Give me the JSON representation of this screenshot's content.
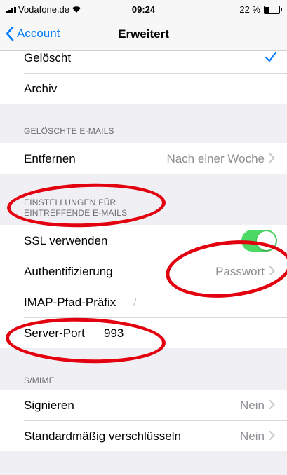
{
  "status_bar": {
    "carrier": "Vodafone.de",
    "time": "09:24",
    "battery": "22 %"
  },
  "nav": {
    "back_label": "Account",
    "title": "Erweitert"
  },
  "mailbox_behavior": {
    "rows": [
      {
        "label": "Gelöscht",
        "checked": true
      },
      {
        "label": "Archiv"
      }
    ]
  },
  "deleted_mails": {
    "header": "GELÖSCHTE E-MAILS",
    "remove": {
      "label": "Entfernen",
      "value": "Nach einer Woche"
    }
  },
  "incoming": {
    "header_line1": "EINSTELLUNGEN FÜR",
    "header_line2": "EINTREFFENDE E-MAILS",
    "ssl": {
      "label": "SSL verwenden",
      "on": true
    },
    "auth": {
      "label": "Authentifizierung",
      "value": "Passwort"
    },
    "imap_prefix": {
      "label": "IMAP-Pfad-Präfix",
      "value": "/"
    },
    "server_port": {
      "label": "Server-Port",
      "value": "993"
    }
  },
  "smime": {
    "header": "S/MIME",
    "sign": {
      "label": "Signieren",
      "value": "Nein"
    },
    "encrypt": {
      "label": "Standardmäßig verschlüsseln",
      "value": "Nein"
    }
  },
  "colors": {
    "accent": "#007aff",
    "toggle_on": "#4cd964",
    "annotation": "#e3000f"
  }
}
